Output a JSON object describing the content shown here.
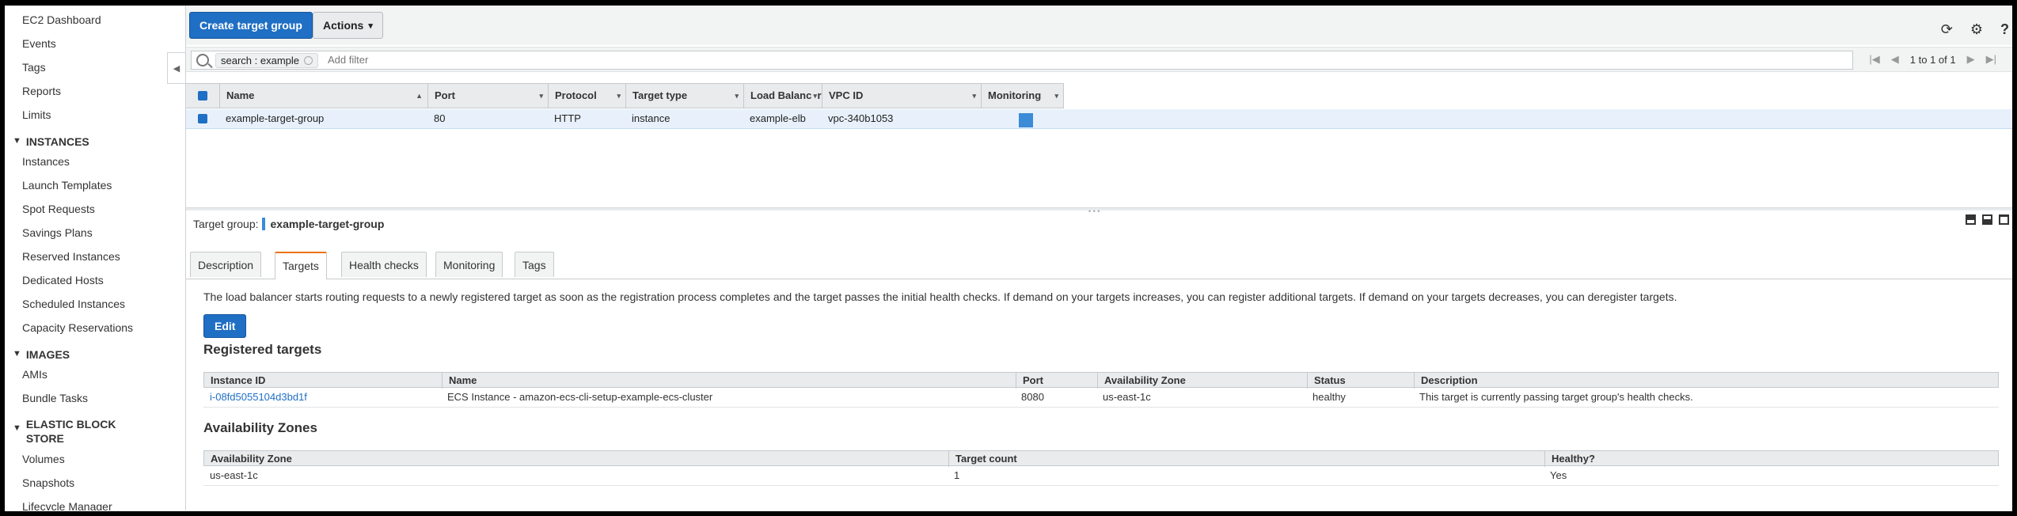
{
  "sidebar": {
    "items_top": [
      "EC2 Dashboard",
      "Events",
      "Tags",
      "Reports",
      "Limits"
    ],
    "sections": [
      {
        "title": "INSTANCES",
        "items": [
          "Instances",
          "Launch Templates",
          "Spot Requests",
          "Savings Plans",
          "Reserved Instances",
          "Dedicated Hosts",
          "Scheduled Instances",
          "Capacity Reservations"
        ]
      },
      {
        "title": "IMAGES",
        "items": [
          "AMIs",
          "Bundle Tasks"
        ]
      },
      {
        "title_line1": "ELASTIC BLOCK",
        "title_line2": "STORE",
        "items": [
          "Volumes",
          "Snapshots",
          "Lifecycle Manager"
        ]
      }
    ],
    "collapse_glyph": "◀"
  },
  "toolbar": {
    "create_label": "Create target group",
    "actions_label": "Actions",
    "actions_caret": "▾",
    "refresh_icon": "⟳",
    "settings_icon": "⚙",
    "help_icon": "?"
  },
  "filter": {
    "token": "search : example",
    "placeholder": "Add filter",
    "pager_first": "|◀",
    "pager_prev": "◀",
    "pager_text": "1 to 1 of 1",
    "pager_next": "▶",
    "pager_last": "▶|"
  },
  "grid": {
    "columns": [
      "Name",
      "Port",
      "Protocol",
      "Target type",
      "Load Balancer",
      "VPC ID",
      "Monitoring"
    ],
    "sort_glyphs": [
      "▲",
      "▾",
      "▾",
      "▾",
      "▾",
      "▾",
      "▾"
    ],
    "row": {
      "name": "example-target-group",
      "port": "80",
      "protocol": "HTTP",
      "target_type": "instance",
      "load_balancer": "example-elb",
      "vpc_id": "vpc-340b1053"
    }
  },
  "detail": {
    "title_prefix": "Target group:",
    "title_value": "example-target-group",
    "tabs": [
      "Description",
      "Targets",
      "Health checks",
      "Monitoring",
      "Tags"
    ],
    "active_tab": "Targets",
    "help_text": "The load balancer starts routing requests to a newly registered target as soon as the registration process completes and the target passes the initial health checks. If demand on your targets increases, you can register additional targets. If demand on your targets decreases, you can deregister targets.",
    "edit_label": "Edit",
    "registered_title": "Registered targets",
    "registered_columns": [
      "Instance ID",
      "Name",
      "Port",
      "Availability Zone",
      "Status",
      "Description"
    ],
    "registered_rows": [
      {
        "instance_id": "i-08fd5055104d3bd1f",
        "name": "ECS Instance - amazon-ecs-cli-setup-example-ecs-cluster",
        "port": "8080",
        "az": "us-east-1c",
        "status": "healthy",
        "description": "This target is currently passing target group's health checks."
      }
    ],
    "az_title": "Availability Zones",
    "az_columns": [
      "Availability Zone",
      "Target count",
      "Healthy?"
    ],
    "az_rows": [
      {
        "az": "us-east-1c",
        "count": "1",
        "healthy": "Yes"
      }
    ]
  }
}
